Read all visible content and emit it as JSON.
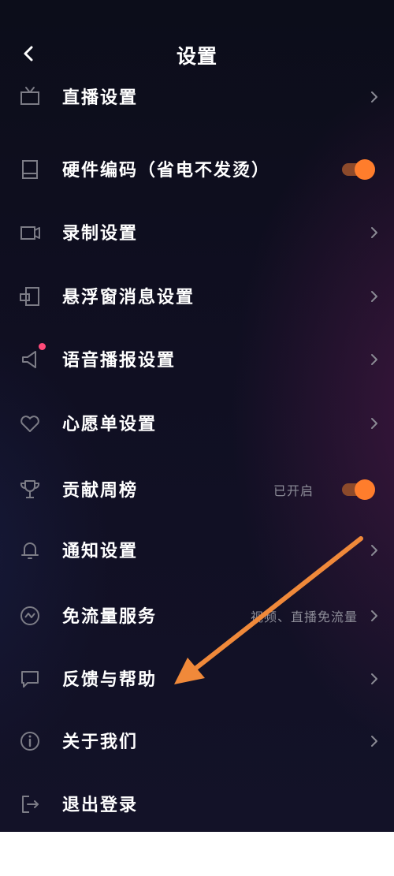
{
  "header": {
    "title": "设置"
  },
  "items": [
    {
      "label": "直播设置",
      "icon": "tv-icon"
    },
    {
      "label": "硬件编码（省电不发烫）",
      "icon": "device-icon",
      "toggle": true
    },
    {
      "label": "录制设置",
      "icon": "video-record-icon"
    },
    {
      "label": "悬浮窗消息设置",
      "icon": "floating-window-icon"
    },
    {
      "label": "语音播报设置",
      "icon": "speaker-icon",
      "badge": "red-dot"
    },
    {
      "label": "心愿单设置",
      "icon": "heart-icon"
    },
    {
      "label": "贡献周榜",
      "icon": "trophy-icon",
      "value": "已开启",
      "toggle": true
    },
    {
      "label": "通知设置",
      "icon": "bell-icon"
    },
    {
      "label": "免流量服务",
      "icon": "flow-icon",
      "value": "视频、直播免流量"
    },
    {
      "label": "反馈与帮助",
      "icon": "chat-icon"
    },
    {
      "label": "关于我们",
      "icon": "info-icon"
    },
    {
      "label": "退出登录",
      "icon": "logout-icon"
    }
  ],
  "colors": {
    "accent": "#ff7d2c",
    "toggle_track": "#8c4a2b",
    "badge": "#ff4a79",
    "annotation_arrow": "#f0893a"
  }
}
